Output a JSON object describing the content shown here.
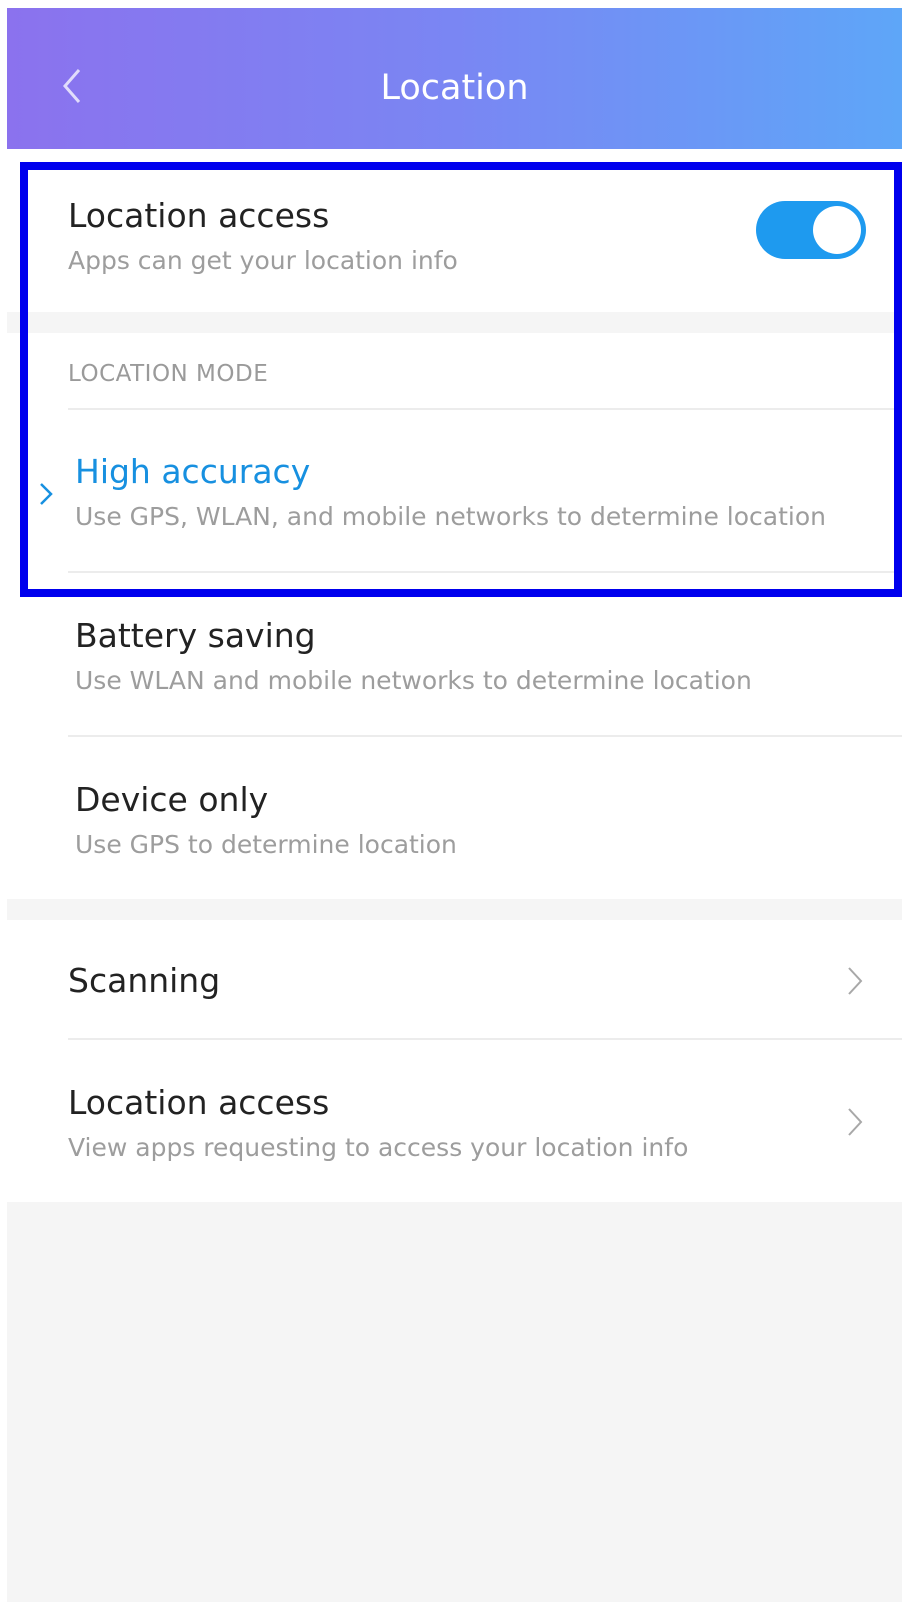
{
  "header": {
    "title": "Location"
  },
  "location_access": {
    "title": "Location access",
    "subtitle": "Apps can get your location info",
    "toggle_on": true
  },
  "location_mode": {
    "label": "LOCATION MODE",
    "options": [
      {
        "title": "High accuracy",
        "subtitle": "Use GPS, WLAN, and mobile networks to determine location",
        "selected": true
      },
      {
        "title": "Battery saving",
        "subtitle": "Use WLAN and mobile networks to determine location",
        "selected": false
      },
      {
        "title": "Device only",
        "subtitle": "Use GPS to determine location",
        "selected": false
      }
    ]
  },
  "more": [
    {
      "title": "Scanning"
    },
    {
      "title": "Location access",
      "subtitle": "View apps requesting to access your location info"
    }
  ],
  "colors": {
    "accent": "#1790e0",
    "toggle": "#1e9aef",
    "highlight_box": "#0000ee",
    "header_gradient_start": "#8b72ee",
    "header_gradient_end": "#5ea6f8"
  },
  "icons": {
    "back": "chevron-left-icon",
    "selected_marker": "chevron-right-icon",
    "row_arrow": "chevron-right-icon"
  }
}
